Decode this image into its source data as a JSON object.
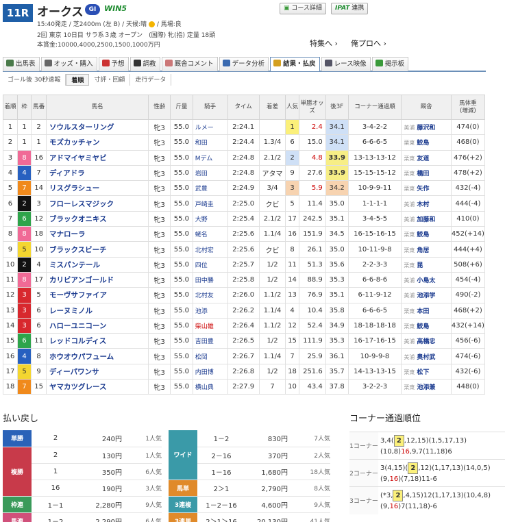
{
  "race": {
    "no": "11R",
    "name": "オークス",
    "grade": "GI",
    "win5": "WIN5",
    "info1a": "15:40発走 / 芝2400m (左 B) / 天候:晴",
    "info1b": "/ 馬場:良",
    "info2": "2回 東京 10日目 サラ系３歳 オープン　(国際) 牝(指) 定量 18頭",
    "info3": "本賞金:10000,4000,2500,1500,1000万円"
  },
  "top_buttons": {
    "course": "コース詳細",
    "ipat": "IPAT",
    "ipat_suffix": "連携"
  },
  "links": {
    "tokushu": "特集へ ›",
    "orepro": "俺プロへ ›"
  },
  "tabs": [
    {
      "label": "出馬表",
      "color": "#4a7a4a"
    },
    {
      "label": "オッズ・購入",
      "color": "#666"
    },
    {
      "label": "予想",
      "color": "#c33"
    },
    {
      "label": "調教",
      "color": "#333"
    },
    {
      "label": "厩舎コメント",
      "color": "#c77"
    },
    {
      "label": "データ分析",
      "color": "#3a6ab0"
    },
    {
      "label": "結果・払戻",
      "color": "#d4a020"
    },
    {
      "label": "レース映像",
      "color": "#556"
    },
    {
      "label": "掲示板",
      "color": "#3a9a3a"
    }
  ],
  "subtabs": [
    "ゴール後 30秒速報",
    "着順",
    "寸評・回顧",
    "走行データ"
  ],
  "headers": {
    "rank": "着順",
    "waku": "枠",
    "umaban": "馬番",
    "name": "馬名",
    "sex": "性齢",
    "kinryo": "斤量",
    "jockey": "騎手",
    "time": "タイム",
    "margin": "着差",
    "pop": "人気",
    "odds": "単勝オッズ",
    "last3f": "後3F",
    "corner": "コーナー通過順",
    "trainer": "厩舎",
    "weight": "馬体重",
    "weight_sub": "(増減)"
  },
  "waku_colors": {
    "1": "#ffffff",
    "2": "#111111",
    "3": "#d8282e",
    "4": "#2760c0",
    "5": "#f4d630",
    "6": "#2ea44a",
    "7": "#f08a1c",
    "8": "#f06a96"
  },
  "rows": [
    {
      "rank": "1",
      "waku": "1",
      "umaban": "2",
      "name": "ソウルスターリング",
      "sex": "牝3",
      "kinryo": "55.0",
      "jockey": "ルメー",
      "time": "2:24.1",
      "margin": "",
      "pop": "1",
      "odds": "2.4",
      "last3f": "34.1",
      "corner": "3-4-2-2",
      "region": "美浦",
      "trainer": "藤沢和",
      "weight": "474(0)"
    },
    {
      "rank": "2",
      "waku": "1",
      "umaban": "1",
      "name": "モズカッチャン",
      "sex": "牝3",
      "kinryo": "55.0",
      "jockey": "和田",
      "time": "2:24.4",
      "margin": "1.3/4",
      "pop": "6",
      "odds": "15.0",
      "last3f": "34.1",
      "corner": "6-6-6-5",
      "region": "栗東",
      "trainer": "鮫島",
      "weight": "468(0)"
    },
    {
      "rank": "3",
      "waku": "8",
      "umaban": "16",
      "name": "アドマイヤミヤビ",
      "sex": "牝3",
      "kinryo": "55.0",
      "jockey": "Mデム",
      "time": "2:24.8",
      "margin": "2.1/2",
      "pop": "2",
      "odds": "4.8",
      "last3f": "33.9",
      "corner": "13-13-13-12",
      "region": "栗東",
      "trainer": "友道",
      "weight": "476(+2)"
    },
    {
      "rank": "4",
      "waku": "4",
      "umaban": "7",
      "name": "ディアドラ",
      "sex": "牝3",
      "kinryo": "55.0",
      "jockey": "岩田",
      "time": "2:24.8",
      "margin": "アタマ",
      "pop": "9",
      "odds": "27.6",
      "last3f": "33.9",
      "corner": "15-15-15-12",
      "region": "栗東",
      "trainer": "橋田",
      "weight": "478(+2)"
    },
    {
      "rank": "5",
      "waku": "7",
      "umaban": "14",
      "name": "リスグラシュー",
      "sex": "牝3",
      "kinryo": "55.0",
      "jockey": "武豊",
      "time": "2:24.9",
      "margin": "3/4",
      "pop": "3",
      "odds": "5.9",
      "last3f": "34.2",
      "corner": "10-9-9-11",
      "region": "栗東",
      "trainer": "矢作",
      "weight": "432(-4)"
    },
    {
      "rank": "6",
      "waku": "2",
      "umaban": "3",
      "name": "フローレスマジック",
      "sex": "牝3",
      "kinryo": "55.0",
      "jockey": "戸崎圭",
      "time": "2:25.0",
      "margin": "クビ",
      "pop": "5",
      "odds": "11.4",
      "last3f": "35.0",
      "corner": "1-1-1-1",
      "region": "美浦",
      "trainer": "木村",
      "weight": "444(-4)"
    },
    {
      "rank": "7",
      "waku": "6",
      "umaban": "12",
      "name": "ブラックオニキス",
      "sex": "牝3",
      "kinryo": "55.0",
      "jockey": "大野",
      "time": "2:25.4",
      "margin": "2.1/2",
      "pop": "17",
      "odds": "242.5",
      "last3f": "35.1",
      "corner": "3-4-5-5",
      "region": "美浦",
      "trainer": "加藤和",
      "weight": "410(0)"
    },
    {
      "rank": "8",
      "waku": "8",
      "umaban": "18",
      "name": "マナローラ",
      "sex": "牝3",
      "kinryo": "55.0",
      "jockey": "蛯名",
      "time": "2:25.6",
      "margin": "1.1/4",
      "pop": "16",
      "odds": "151.9",
      "last3f": "34.5",
      "corner": "16-15-16-15",
      "region": "栗東",
      "trainer": "鮫島",
      "weight": "452(+14)"
    },
    {
      "rank": "9",
      "waku": "5",
      "umaban": "10",
      "name": "ブラックスビーチ",
      "sex": "牝3",
      "kinryo": "55.0",
      "jockey": "北村宏",
      "time": "2:25.6",
      "margin": "クビ",
      "pop": "8",
      "odds": "26.1",
      "last3f": "35.0",
      "corner": "10-11-9-8",
      "region": "栗東",
      "trainer": "角居",
      "weight": "444(+4)"
    },
    {
      "rank": "10",
      "waku": "2",
      "umaban": "4",
      "name": "ミスパンテール",
      "sex": "牝3",
      "kinryo": "55.0",
      "jockey": "四位",
      "time": "2:25.7",
      "margin": "1/2",
      "pop": "11",
      "odds": "51.3",
      "last3f": "35.6",
      "corner": "2-2-3-3",
      "region": "栗東",
      "trainer": "昆",
      "weight": "508(+6)"
    },
    {
      "rank": "11",
      "waku": "8",
      "umaban": "17",
      "name": "カリビアンゴールド",
      "sex": "牝3",
      "kinryo": "55.0",
      "jockey": "田中勝",
      "time": "2:25.8",
      "margin": "1/2",
      "pop": "14",
      "odds": "88.9",
      "last3f": "35.3",
      "corner": "6-6-8-6",
      "region": "美浦",
      "trainer": "小島太",
      "weight": "454(-4)"
    },
    {
      "rank": "12",
      "waku": "3",
      "umaban": "5",
      "name": "モーヴサファイア",
      "sex": "牝3",
      "kinryo": "55.0",
      "jockey": "北村友",
      "time": "2:26.0",
      "margin": "1.1/2",
      "pop": "13",
      "odds": "76.9",
      "last3f": "35.1",
      "corner": "6-11-9-12",
      "region": "美浦",
      "trainer": "池添学",
      "weight": "490(-2)"
    },
    {
      "rank": "13",
      "waku": "3",
      "umaban": "6",
      "name": "レーヌミノル",
      "sex": "牝3",
      "kinryo": "55.0",
      "jockey": "池添",
      "time": "2:26.2",
      "margin": "1.1/4",
      "pop": "4",
      "odds": "10.4",
      "last3f": "35.8",
      "corner": "6-6-6-5",
      "region": "栗東",
      "trainer": "本田",
      "weight": "468(+2)"
    },
    {
      "rank": "14",
      "waku": "3",
      "umaban": "6",
      "name": "ハローユニコーン",
      "sex": "牝3",
      "kinryo": "55.0",
      "jockey": "柴山雄",
      "jockey_red": true,
      "time": "2:26.4",
      "margin": "1.1/2",
      "pop": "12",
      "odds": "52.4",
      "last3f": "34.9",
      "corner": "18-18-18-18",
      "region": "栗東",
      "trainer": "鮫島",
      "weight": "432(+14)"
    },
    {
      "rank": "15",
      "waku": "6",
      "umaban": "11",
      "name": "レッドコルディス",
      "sex": "牝3",
      "kinryo": "55.0",
      "jockey": "吉田豊",
      "time": "2:26.5",
      "margin": "1/2",
      "pop": "15",
      "odds": "111.9",
      "last3f": "35.3",
      "corner": "16-17-16-15",
      "region": "美浦",
      "trainer": "高橋忠",
      "weight": "456(-6)"
    },
    {
      "rank": "16",
      "waku": "4",
      "umaban": "8",
      "name": "ホウオウパフューム",
      "sex": "牝3",
      "kinryo": "55.0",
      "jockey": "松岡",
      "time": "2:26.7",
      "margin": "1.1/4",
      "pop": "7",
      "odds": "25.9",
      "last3f": "36.1",
      "corner": "10-9-9-8",
      "region": "美浦",
      "trainer": "奥村武",
      "weight": "474(-6)"
    },
    {
      "rank": "17",
      "waku": "5",
      "umaban": "9",
      "name": "ディーパワンサ",
      "sex": "牝3",
      "kinryo": "55.0",
      "jockey": "内田博",
      "time": "2:26.8",
      "margin": "1/2",
      "pop": "18",
      "odds": "251.6",
      "last3f": "35.7",
      "corner": "14-13-13-15",
      "region": "栗東",
      "trainer": "松下",
      "weight": "432(-6)"
    },
    {
      "rank": "18",
      "waku": "7",
      "umaban": "15",
      "name": "ヤマカツグレース",
      "sex": "牝3",
      "kinryo": "55.0",
      "jockey": "横山典",
      "time": "2:27.9",
      "margin": "7",
      "pop": "10",
      "odds": "43.4",
      "last3f": "37.8",
      "corner": "3-2-2-3",
      "region": "栗東",
      "trainer": "池添兼",
      "weight": "448(0)"
    }
  ],
  "payout_title": "払い戻し",
  "payout_left": [
    {
      "type": "単勝",
      "color": "#2a62b8",
      "lines": [
        {
          "num": "2",
          "yen": "240円",
          "pop": "1人気"
        }
      ]
    },
    {
      "type": "複勝",
      "color": "#c83a4a",
      "lines": [
        {
          "num": "2",
          "yen": "130円",
          "pop": "1人気"
        },
        {
          "num": "1",
          "yen": "350円",
          "pop": "6人気"
        },
        {
          "num": "16",
          "yen": "190円",
          "pop": "3人気"
        }
      ]
    },
    {
      "type": "枠連",
      "color": "#3a9a5a",
      "lines": [
        {
          "num": "1－1",
          "yen": "2,280円",
          "pop": "9人気"
        }
      ]
    },
    {
      "type": "馬連",
      "color": "#d0507a",
      "lines": [
        {
          "num": "1－2",
          "yen": "2,290円",
          "pop": "6人気"
        }
      ]
    }
  ],
  "payout_right": [
    {
      "type": "ワイド",
      "color": "#3a9aa8",
      "lines": [
        {
          "num": "1－2",
          "yen": "830円",
          "pop": "7人気"
        },
        {
          "num": "2－16",
          "yen": "370円",
          "pop": "2人気"
        },
        {
          "num": "1－16",
          "yen": "1,680円",
          "pop": "18人気"
        }
      ]
    },
    {
      "type": "馬単",
      "color": "#e08a2a",
      "lines": [
        {
          "num": "2＞1",
          "yen": "2,790円",
          "pop": "8人気"
        }
      ]
    },
    {
      "type": "3連複",
      "color": "#3a9aa8",
      "lines": [
        {
          "num": "1－2－16",
          "yen": "4,600円",
          "pop": "9人気"
        }
      ]
    },
    {
      "type": "3連単",
      "color": "#e08a2a",
      "lines": [
        {
          "num": "2＞1＞16",
          "yen": "20,130円",
          "pop": "41人気"
        }
      ]
    }
  ],
  "corner_title": "コーナー通過順位",
  "corners": [
    {
      "label": "1コーナー",
      "pre": "3,4(",
      "box": "2",
      "post": ",12,15)(1,5,17,13)(10,8)",
      "red": "16",
      "tail": ",9,7(11,18)6"
    },
    {
      "label": "2コーナー",
      "pre": "3(4,15)(",
      "box": "2",
      "post": ",12)(1,17,13)(14,0,5)(9,",
      "red": "16",
      "tail": ")(7,18)11-6"
    },
    {
      "label": "3コーナー",
      "pre": "(*3,",
      "box": "2",
      "post": ",4,15)12(1,17,13)(10,4,8)(9,",
      "red": "16",
      "tail": ")7(11,18)-6"
    }
  ]
}
